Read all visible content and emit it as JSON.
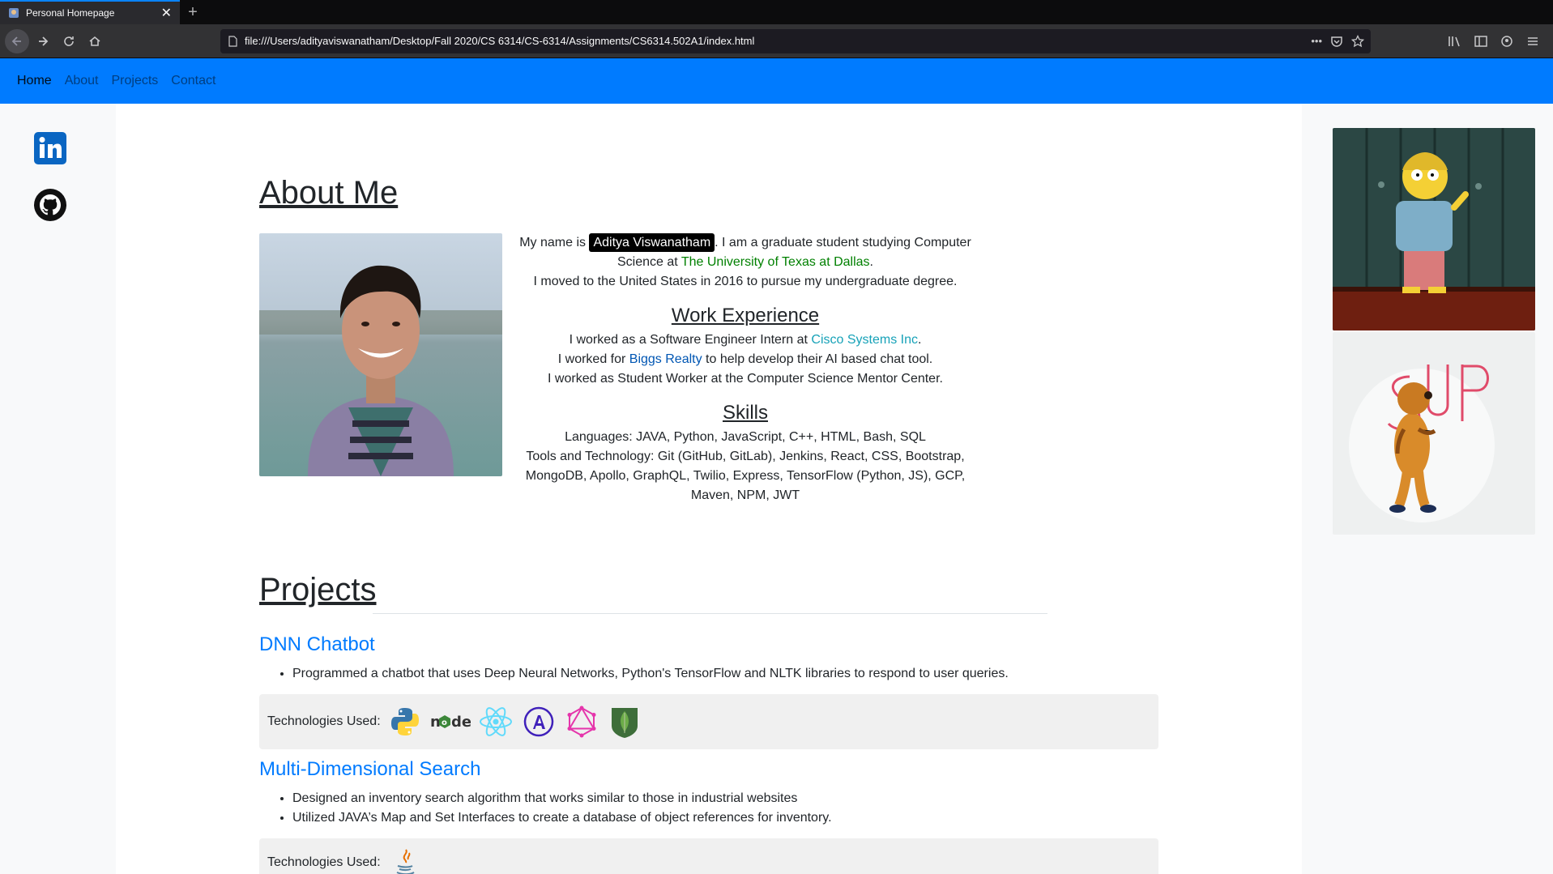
{
  "browser": {
    "tab_title": "Personal Homepage",
    "tab_close": "✕",
    "new_tab": "+",
    "url": "file:///Users/adityaviswanatham/Desktop/Fall 2020/CS 6314/CS-6314/Assignments/CS6314.502A1/index.html"
  },
  "navbar": {
    "items": [
      "Home",
      "About",
      "Projects",
      "Contact"
    ]
  },
  "about": {
    "title": "About Me",
    "intro_prefix": "My name is ",
    "name": "Aditya Viswanatham",
    "intro_mid": ". I am a graduate student studying Computer Science at ",
    "university": "The University of Texas at Dallas",
    "intro_end": ".",
    "moved": "I moved to the United States in 2016 to pursue my undergraduate degree.",
    "work_title": "Work Experience",
    "work1_prefix": "I worked as a Software Engineer Intern at ",
    "work1_link": "Cisco Systems Inc",
    "work1_end": ".",
    "work2_prefix": "I worked for ",
    "work2_link": "Biggs Realty",
    "work2_end": " to help develop their AI based chat tool.",
    "work3": "I worked as Student Worker at the Computer Science Mentor Center.",
    "skills_title": "Skills",
    "languages": "Languages: JAVA, Python, JavaScript, C++, HTML, Bash, SQL",
    "tools": "Tools and Technology: Git (GitHub, GitLab), Jenkins, React, CSS, Bootstrap, MongoDB, Apollo, GraphQL, Twilio, Express, TensorFlow (Python, JS), GCP, Maven, NPM, JWT"
  },
  "projects": {
    "title": "Projects",
    "tech_label": "Technologies Used:",
    "items": [
      {
        "name": "DNN Chatbot",
        "bullets": [
          "Programmed a chatbot that uses Deep Neural Networks, Python's TensorFlow and NLTK libraries to respond to user queries."
        ],
        "tech_icons": [
          "python-icon",
          "nodejs-icon",
          "react-icon",
          "apollo-icon",
          "graphql-icon",
          "mongodb-icon"
        ]
      },
      {
        "name": "Multi-Dimensional Search",
        "bullets": [
          "Designed an inventory search algorithm that works similar to those in industrial websites",
          "Utilized JAVA’s Map and Set Interfaces to create a database of object references for inventory."
        ],
        "tech_icons": [
          "java-icon"
        ]
      }
    ]
  },
  "social": [
    "linkedin-icon",
    "github-icon"
  ],
  "colors": {
    "navbar": "#007bff",
    "university": "#008000",
    "project_title": "#007bff",
    "cisco_link": "#17a2b8",
    "biggs_link": "#0056b3"
  }
}
